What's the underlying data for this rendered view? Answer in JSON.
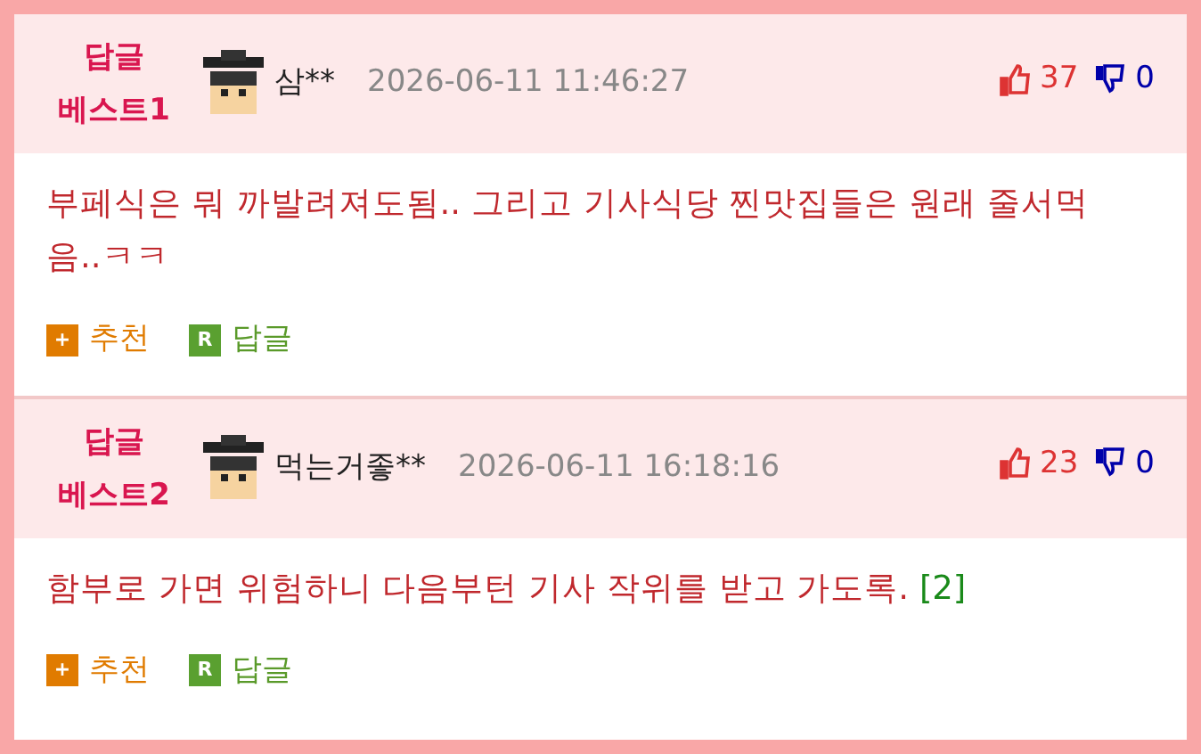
{
  "comments": [
    {
      "best_label": "답글",
      "best_rank": "베스트1",
      "author": "삼**",
      "date": "2026-06-11 11:46:27",
      "likes": "37",
      "dislikes": "0",
      "text": "부페식은 뭐 까발려져도됨.. 그리고 기사식당 찐맛집들은 원래 줄서먹음..ㅋㅋ",
      "recommend_icon": "+",
      "recommend": "추천",
      "reply_icon": "R",
      "reply": "답글"
    },
    {
      "best_label": "답글",
      "best_rank": "베스트2",
      "author": "먹는거좋**",
      "date": "2026-06-11 16:18:16",
      "likes": "23",
      "dislikes": "0",
      "text": "함부로 가면 위험하니 다음부턴 기사 작위를 받고 가도록.",
      "reply_count": "[2]",
      "recommend_icon": "+",
      "recommend": "추천",
      "reply_icon": "R",
      "reply": "답글"
    }
  ]
}
